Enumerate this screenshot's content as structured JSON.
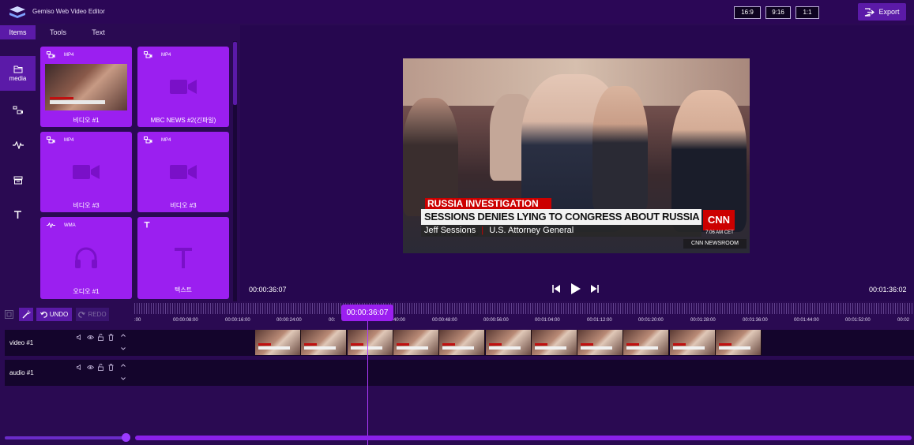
{
  "header": {
    "app_title": "Gemiso Web Video Editor",
    "ratios": [
      "16:9",
      "9:16",
      "1:1"
    ],
    "export_label": "Export"
  },
  "tabs": [
    "Items",
    "Tools",
    "Text"
  ],
  "sidenav": {
    "media_label": "media"
  },
  "media": [
    {
      "type": "MP4",
      "name": "비디오 #1"
    },
    {
      "type": "MP4",
      "name": "MBC NEWS #2(긴파일)"
    },
    {
      "type": "MP4",
      "name": "비디오 #3"
    },
    {
      "type": "MP4",
      "name": "비디오 #3"
    },
    {
      "type": "WMA",
      "name": "오디오 #1"
    },
    {
      "type": "",
      "name": "텍스트"
    }
  ],
  "preview": {
    "headline_top": "RUSSIA INVESTIGATION",
    "headline_main": "SESSIONS DENIES LYING TO CONGRESS ABOUT RUSSIA CONTACTS",
    "name_line_name": "Jeff Sessions",
    "name_line_title": "U.S. Attorney General",
    "network": "CNN",
    "network_time": "7:06 AM CET",
    "network_show": "CNN NEWSROOM",
    "time_current": "00:00:36:07",
    "time_total": "00:01:36:02"
  },
  "timeline": {
    "undo_label": "UNDO",
    "redo_label": "REDO",
    "playhead_time": "00:00:36:07",
    "ruler_labels": [
      ":00",
      "00:00:08:00",
      "00:00:16:00",
      "00:00:24:00",
      "00:",
      "40:00",
      "00:00:48:00",
      "00:00:56:00",
      "00:01:04:00",
      "00:01:12:00",
      "00:01:20:00",
      "00:01:28:00",
      "00:01:36:00",
      "00:01:44:00",
      "00:01:52:00",
      "00:02"
    ],
    "tracks": [
      {
        "name": "video #1"
      },
      {
        "name": "audio #1"
      }
    ]
  },
  "colors": {
    "background": "#2a0a52",
    "accent": "#9b1ff0",
    "active": "#5b1aa8"
  }
}
